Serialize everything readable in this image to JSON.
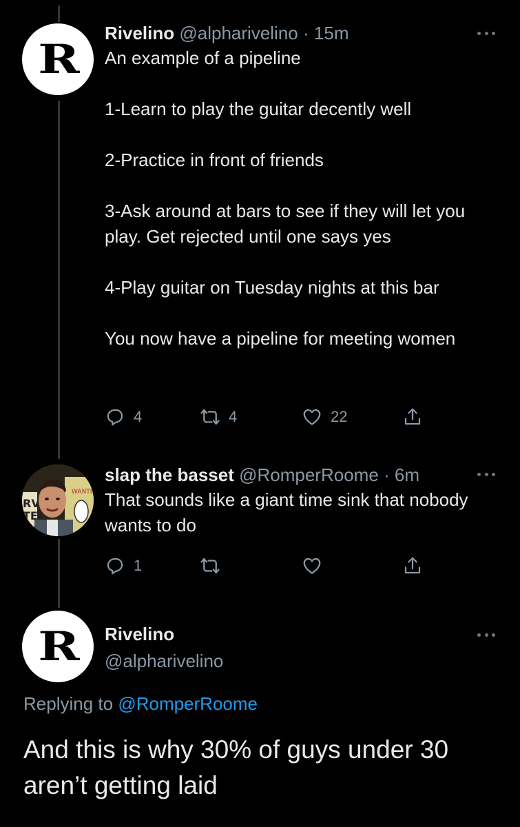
{
  "tweet1": {
    "name": "Rivelino",
    "handle": "@alpharivelino",
    "dot": "·",
    "time": "15m",
    "avatar_letter": "R",
    "body": "An example of a pipeline\n\n1-Learn to play the guitar decently well\n\n2-Practice in front of friends\n\n3-Ask around at bars to see if they will let you play. Get rejected until one says yes\n\n4-Play guitar on Tuesday nights at this bar\n\nYou now have a pipeline for meeting women",
    "replies": "4",
    "retweets": "4",
    "likes": "22"
  },
  "tweet2": {
    "name": "slap the basset",
    "handle": "@RomperRoome",
    "dot": "·",
    "time": "6m",
    "avatar_text": "WANTED",
    "body": "That sounds like a giant time sink that nobody wants to do",
    "replies": "1"
  },
  "main_tweet": {
    "name": "Rivelino",
    "handle": "@alpharivelino",
    "avatar_letter": "R",
    "replying_prefix": "Replying to",
    "replying_to": "@RomperRoome",
    "text": "And this is why 30% of guys under 30 aren’t getting laid"
  },
  "icons": [
    "reply-icon",
    "retweet-icon",
    "like-icon",
    "share-icon",
    "more-icon"
  ],
  "colors": {
    "background": "#000000",
    "text": "#e7e9ea",
    "secondary": "#8b98a5",
    "link": "#1d9bf0",
    "thread_line": "#333639"
  }
}
